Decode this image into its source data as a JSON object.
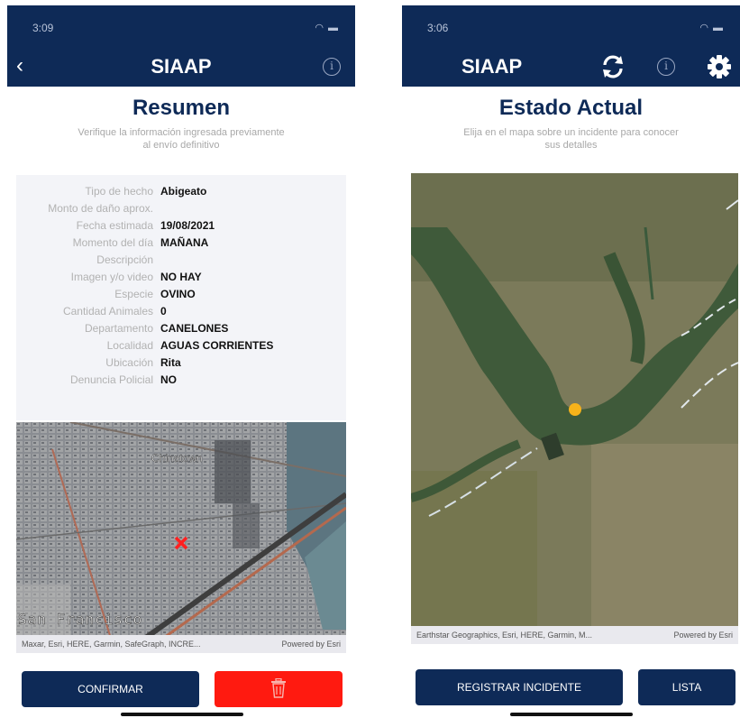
{
  "left": {
    "status": {
      "time": "3:09",
      "indicators": "wifi battery"
    },
    "nav": {
      "title": "SIAAP",
      "back_icon": "chevron-left-icon",
      "info_icon": "info-icon"
    },
    "heading": "Resumen",
    "subheading": "Verifique la información ingresada previamente al envío definitivo",
    "fields": [
      {
        "label": "Tipo de hecho",
        "value": "Abigeato"
      },
      {
        "label": "Monto de daño aprox.",
        "value": ""
      },
      {
        "label": "Fecha estimada",
        "value": "19/08/2021"
      },
      {
        "label": "Momento del día",
        "value": "MAÑANA"
      },
      {
        "label": "Descripción",
        "value": ""
      },
      {
        "label": "Imagen y/o video",
        "value": "NO HAY"
      },
      {
        "label": "Especie",
        "value": "OVINO"
      },
      {
        "label": "Cantidad Animales",
        "value": "0"
      },
      {
        "label": "Departamento",
        "value": "CANELONES"
      },
      {
        "label": "Localidad",
        "value": "AGUAS CORRIENTES"
      },
      {
        "label": "Ubicación",
        "value": "Rita"
      },
      {
        "label": "Denuncia Policial",
        "value": "NO"
      }
    ],
    "map": {
      "labels": {
        "district": "Chinatown",
        "city": "San Francisco"
      },
      "attribution": "Maxar, Esri, HERE, Garmin, SafeGraph, INCRE...",
      "powered": "Powered by Esri",
      "marker": "x-marker-icon",
      "marker_color": "#ff2020"
    },
    "buttons": {
      "confirm": "CONFIRMAR",
      "delete_icon": "trash-icon"
    },
    "colors": {
      "primary": "#0e2a57",
      "danger": "#ff1a10"
    }
  },
  "right": {
    "status": {
      "time": "3:06",
      "indicators": "wifi battery"
    },
    "nav": {
      "title": "SIAAP",
      "sync_icon": "sync-icon",
      "info_icon": "info-icon",
      "settings_icon": "gear-icon"
    },
    "heading": "Estado Actual",
    "subheading": "Elija en el mapa sobre un incidente para conocer sus detalles",
    "map": {
      "attribution": "Earthstar Geographics, Esri, HERE, Garmin, M...",
      "powered": "Powered by Esri",
      "marker": "incident-dot-icon",
      "marker_color": "#f7b21a"
    },
    "buttons": {
      "register": "REGISTRAR INCIDENTE",
      "list": "LISTA"
    }
  }
}
